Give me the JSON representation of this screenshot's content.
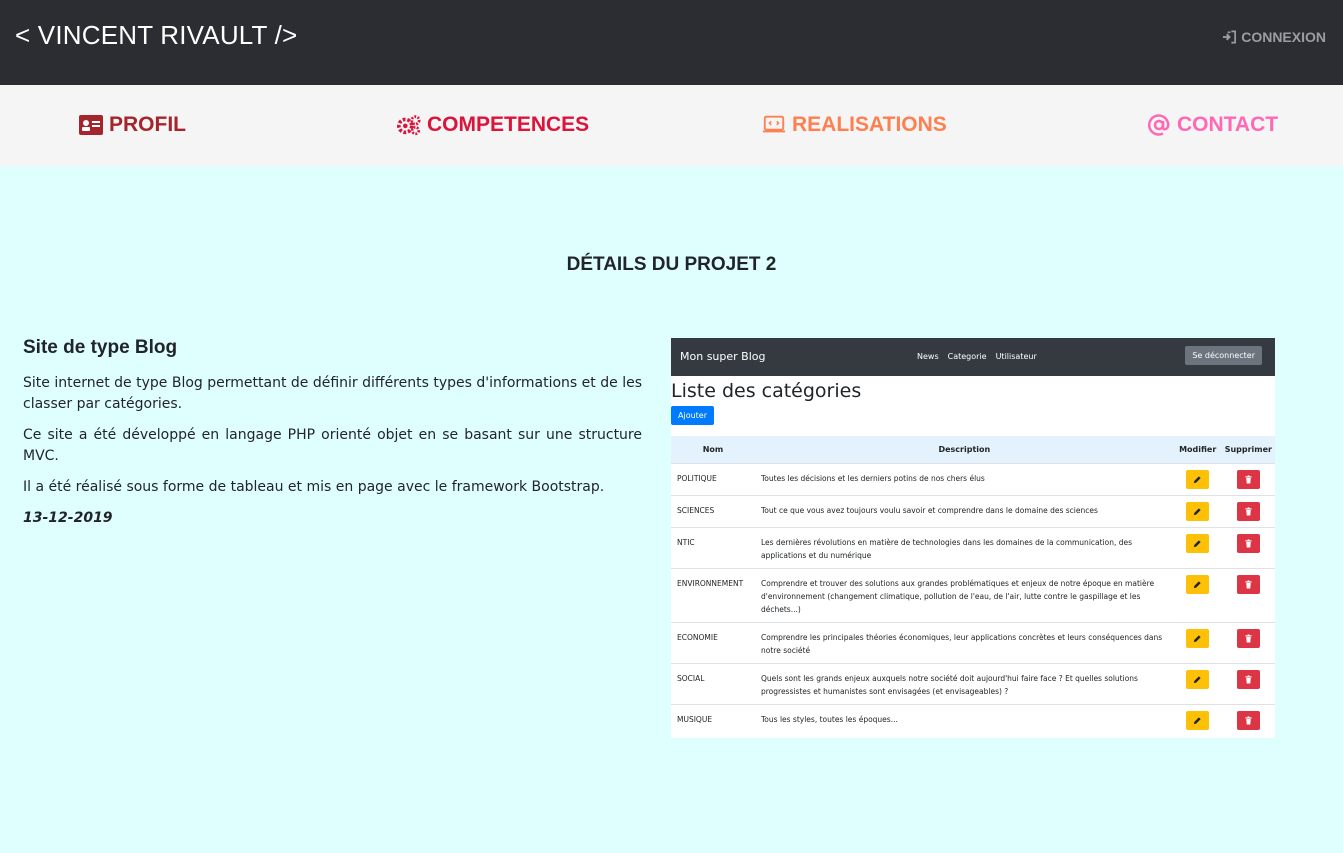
{
  "header": {
    "brand": "< VINCENT RIVAULT />",
    "login_label": "CONNEXION"
  },
  "nav": {
    "items": [
      {
        "label": "PROFIL",
        "icon": "id-card-icon",
        "color": "#a4262c"
      },
      {
        "label": "COMPETENCES",
        "icon": "gears-icon",
        "color": "#dc143c"
      },
      {
        "label": "REALISATIONS",
        "icon": "laptop-code-icon",
        "color": "#ff7f50"
      },
      {
        "label": "CONTACT",
        "icon": "at-icon",
        "color": "#ff69b4"
      }
    ]
  },
  "page": {
    "title": "DÉTAILS DU PROJET 2"
  },
  "project": {
    "heading": "Site de type Blog",
    "paragraphs": [
      "Site internet de type Blog permettant de définir différents types d'informations et de les classer par catégories.",
      "Ce site a été développé en langage PHP orienté objet en se basant sur une structure MVC.",
      "Il a été réalisé sous forme de tableau et mis en page avec le framework Bootstrap."
    ],
    "date": "13-12-2019"
  },
  "screenshot": {
    "brand": "Mon super Blog",
    "links": [
      "News",
      "Categorie",
      "Utilisateur"
    ],
    "logout": "Se déconnecter",
    "title": "Liste des catégories",
    "add_button": "Ajouter",
    "columns": [
      "Nom",
      "Description",
      "Modifier",
      "Supprimer"
    ],
    "rows": [
      {
        "name": "POLITIQUE",
        "description": "Toutes les décisions et les derniers potins de nos chers élus"
      },
      {
        "name": "SCIENCES",
        "description": "Tout ce que vous avez toujours voulu savoir et comprendre dans le domaine des sciences"
      },
      {
        "name": "NTIC",
        "description": "Les dernières révolutions en matière de technologies dans les domaines de la communication, des applications et du numérique"
      },
      {
        "name": "ENVIRONNEMENT",
        "description": "Comprendre et trouver des solutions aux grandes problématiques et enjeux de notre époque en matière d'environnement (changement climatique, pollution de l'eau, de l'air, lutte contre le gaspillage et les déchets...)"
      },
      {
        "name": "ECONOMIE",
        "description": "Comprendre les principales théories économiques, leur applications concrètes et leurs conséquences dans notre société"
      },
      {
        "name": "SOCIAL",
        "description": "Quels sont les grands enjeux auxquels notre société doit aujourd'hui faire face ? Et quelles solutions progressistes et humanistes sont envisagées (et envisageables) ?"
      },
      {
        "name": "MUSIQUE",
        "description": "Tous les styles, toutes les époques..."
      }
    ]
  },
  "colors": {
    "topbar": "#2b2d33",
    "navbar": "#f5f5f5",
    "page_bg": "#dfffff",
    "edit": "#ffc107",
    "delete": "#dc3545",
    "primary": "#007bff"
  }
}
